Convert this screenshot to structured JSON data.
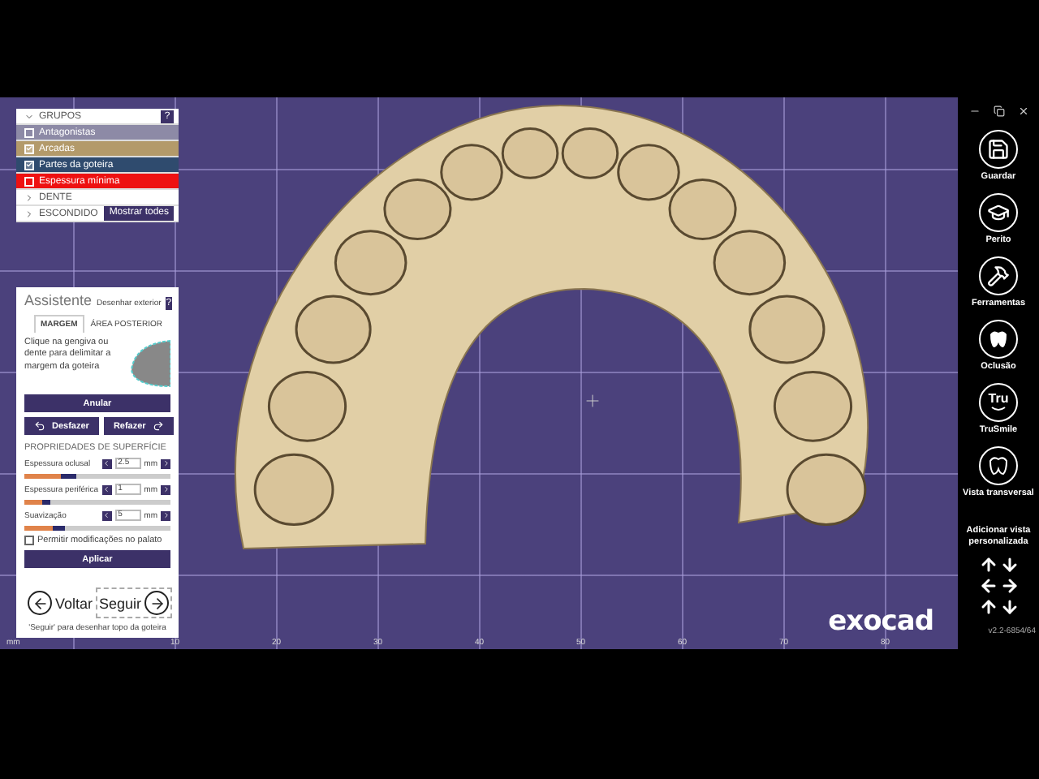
{
  "groups": {
    "header": "GRUPOS",
    "help": "?",
    "items": [
      {
        "label": "Antagonistas",
        "checked": false,
        "color": "#8d8aa6"
      },
      {
        "label": "Arcadas",
        "checked": true,
        "color": "#b39a6a"
      },
      {
        "label": "Partes da goteira",
        "checked": true,
        "color": "#2f4b6e"
      },
      {
        "label": "Espessura mínima",
        "checked": false,
        "color": "#ee1111"
      }
    ],
    "sections": [
      {
        "label": "DENTE"
      },
      {
        "label": "ESCONDIDO"
      }
    ],
    "show_all": "Mostrar todes"
  },
  "assistant": {
    "title": "Assistente",
    "subtitle": "Desenhar exterior",
    "help": "?",
    "tabs": [
      {
        "label": "MARGEM",
        "selected": true
      },
      {
        "label": "ÁREA POSTERIOR",
        "selected": false
      }
    ],
    "instruction": "Clique na gengiva ou dente para delimitar a margem da goteira",
    "undo_all": "Anular",
    "undo": "Desfazer",
    "redo": "Refazer",
    "section": "PROPRIEDADES DE SUPERFÍCIE",
    "sliders": [
      {
        "label": "Espessura oclusal",
        "value": "2.5",
        "unit": "mm",
        "level": 0.35
      },
      {
        "label": "Espessura periférica",
        "value": "1",
        "unit": "mm",
        "level": 0.18
      },
      {
        "label": "Suavização",
        "value": "5",
        "unit": "mm",
        "level": 0.28
      }
    ],
    "option": {
      "label": "Permitir modificações no palato",
      "checked": false
    },
    "apply": "Aplicar",
    "back": "Voltar",
    "next": "Seguir",
    "hint": "'Seguir' para desenhar topo da goteira"
  },
  "axis": {
    "unit": "mm",
    "ticks": [
      "10",
      "20",
      "30",
      "40",
      "50",
      "60",
      "70",
      "80"
    ]
  },
  "logo": "exocad",
  "sidebar": {
    "items": [
      {
        "label": "Guardar"
      },
      {
        "label": "Perito"
      },
      {
        "label": "Ferramentas"
      },
      {
        "label": "Oclusão"
      },
      {
        "label": "TruSmile",
        "icon_text": "Tru"
      },
      {
        "label": "Vista transversal"
      }
    ],
    "custom_view": "Adicionar vista personalizada",
    "version": "v2.2-6854/64"
  }
}
